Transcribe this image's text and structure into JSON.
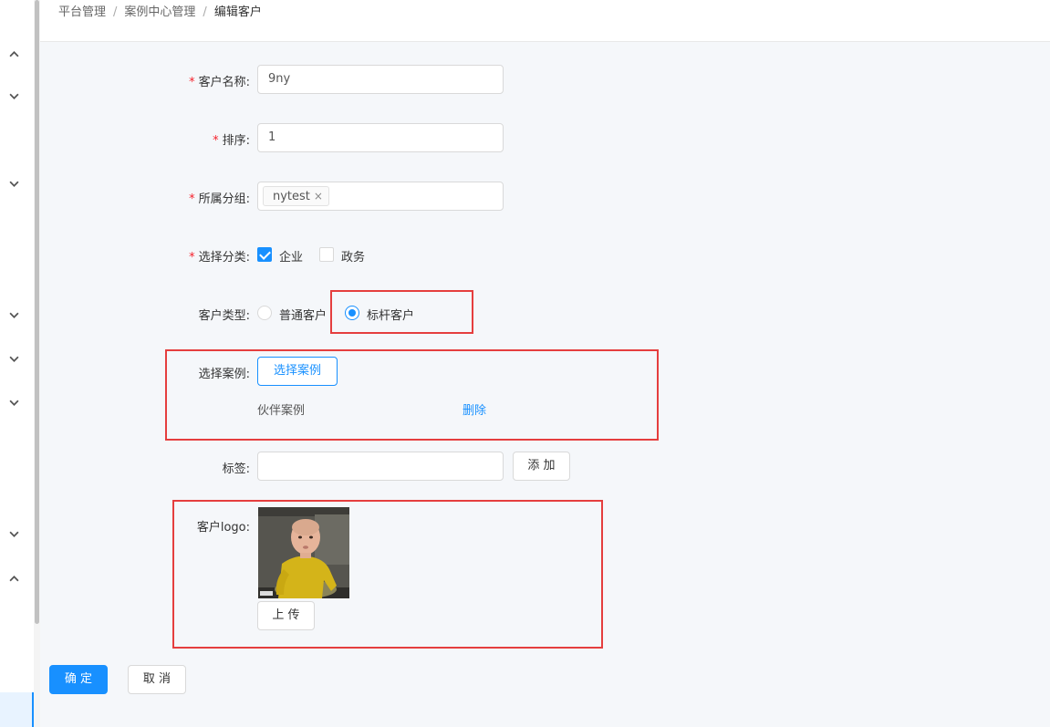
{
  "breadcrumb": [
    "平台管理",
    "案例中心管理",
    "编辑客户"
  ],
  "form": {
    "customer_name": {
      "label": "客户名称:",
      "value": "9ny"
    },
    "sort": {
      "label": "排序:",
      "value": "1"
    },
    "group": {
      "label": "所属分组:",
      "tags": [
        "nytest"
      ],
      "tag_close": "×"
    },
    "category": {
      "label": "选择分类:",
      "options": [
        {
          "label": "企业",
          "checked": true
        },
        {
          "label": "政务",
          "checked": false
        }
      ]
    },
    "customer_type": {
      "label": "客户类型:",
      "options": [
        {
          "label": "普通客户",
          "checked": false
        },
        {
          "label": "标杆客户",
          "checked": true
        }
      ]
    },
    "cases": {
      "label": "选择案例:",
      "button": "选择案例",
      "items": [
        {
          "name": "伙伴案例",
          "action": "删除"
        }
      ]
    },
    "tags": {
      "label": "标签:",
      "value": "",
      "add_button": "添 加"
    },
    "logo": {
      "label": "客户logo:",
      "upload_button": "上 传"
    }
  },
  "actions": {
    "confirm": "确 定",
    "cancel": "取 消"
  },
  "colors": {
    "primary": "#1890ff",
    "required": "#f5222d",
    "highlight_box": "#e53e3e"
  },
  "sidebar": {
    "chevrons": [
      "chevron-up",
      "chevron-down",
      "chevron-down",
      "chevron-down",
      "chevron-down",
      "chevron-down",
      "chevron-down",
      "chevron-up"
    ]
  }
}
